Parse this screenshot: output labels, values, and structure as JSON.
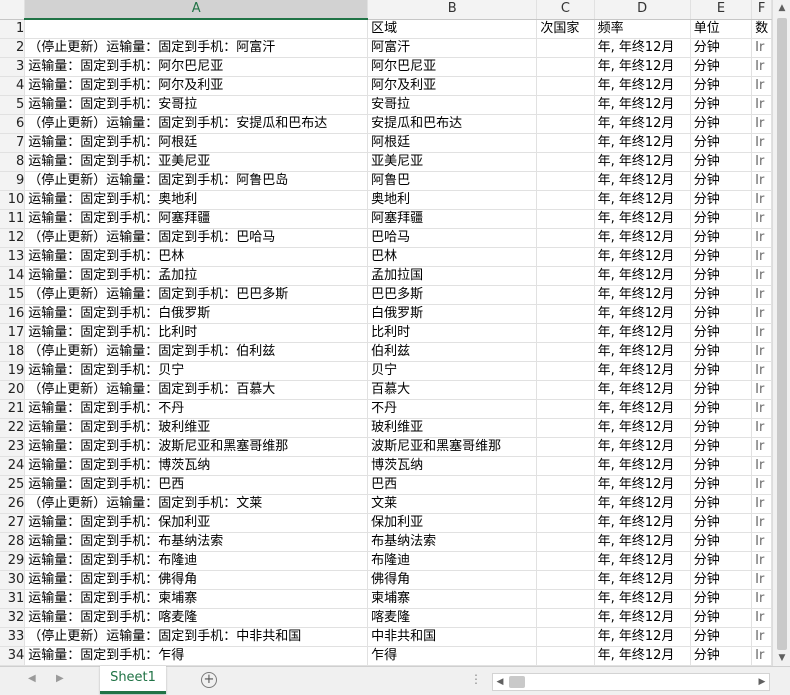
{
  "columns": [
    "A",
    "B",
    "C",
    "D",
    "E",
    "F"
  ],
  "selected_column": "A",
  "header_row": {
    "num": "1",
    "a": "",
    "b": "区域",
    "c": "次国家",
    "d": "频率",
    "e": "单位",
    "f": "数"
  },
  "rows": [
    {
      "num": "2",
      "a": "（停止更新）运输量：固定到手机：阿富汗",
      "b": "阿富汗",
      "d": "年, 年终12月",
      "e": "分钟",
      "f": "Ir"
    },
    {
      "num": "3",
      "a": "运输量：固定到手机：阿尔巴尼亚",
      "b": "阿尔巴尼亚",
      "d": "年, 年终12月",
      "e": "分钟",
      "f": "Ir"
    },
    {
      "num": "4",
      "a": "运输量：固定到手机：阿尔及利亚",
      "b": "阿尔及利亚",
      "d": "年, 年终12月",
      "e": "分钟",
      "f": "Ir"
    },
    {
      "num": "5",
      "a": "运输量：固定到手机：安哥拉",
      "b": "安哥拉",
      "d": "年, 年终12月",
      "e": "分钟",
      "f": "Ir"
    },
    {
      "num": "6",
      "a": "（停止更新）运输量：固定到手机：安提瓜和巴布达",
      "b": "安提瓜和巴布达",
      "d": "年, 年终12月",
      "e": "分钟",
      "f": "Ir"
    },
    {
      "num": "7",
      "a": "运输量：固定到手机：阿根廷",
      "b": "阿根廷",
      "d": "年, 年终12月",
      "e": "分钟",
      "f": "Ir"
    },
    {
      "num": "8",
      "a": "运输量：固定到手机：亚美尼亚",
      "b": "亚美尼亚",
      "d": "年, 年终12月",
      "e": "分钟",
      "f": "Ir"
    },
    {
      "num": "9",
      "a": "（停止更新）运输量：固定到手机：阿鲁巴岛",
      "b": "阿鲁巴",
      "d": "年, 年终12月",
      "e": "分钟",
      "f": "Ir"
    },
    {
      "num": "10",
      "a": "运输量：固定到手机：奥地利",
      "b": "奥地利",
      "d": "年, 年终12月",
      "e": "分钟",
      "f": "Ir"
    },
    {
      "num": "11",
      "a": "运输量：固定到手机：阿塞拜疆",
      "b": "阿塞拜疆",
      "d": "年, 年终12月",
      "e": "分钟",
      "f": "Ir"
    },
    {
      "num": "12",
      "a": "（停止更新）运输量：固定到手机：巴哈马",
      "b": "巴哈马",
      "d": "年, 年终12月",
      "e": "分钟",
      "f": "Ir"
    },
    {
      "num": "13",
      "a": "运输量：固定到手机：巴林",
      "b": "巴林",
      "d": "年, 年终12月",
      "e": "分钟",
      "f": "Ir"
    },
    {
      "num": "14",
      "a": "运输量：固定到手机：孟加拉",
      "b": "孟加拉国",
      "d": "年, 年终12月",
      "e": "分钟",
      "f": "Ir"
    },
    {
      "num": "15",
      "a": "（停止更新）运输量：固定到手机：巴巴多斯",
      "b": "巴巴多斯",
      "d": "年, 年终12月",
      "e": "分钟",
      "f": "Ir"
    },
    {
      "num": "16",
      "a": "运输量：固定到手机：白俄罗斯",
      "b": "白俄罗斯",
      "d": "年, 年终12月",
      "e": "分钟",
      "f": "Ir"
    },
    {
      "num": "17",
      "a": "运输量：固定到手机：比利时",
      "b": "比利时",
      "d": "年, 年终12月",
      "e": "分钟",
      "f": "Ir"
    },
    {
      "num": "18",
      "a": "（停止更新）运输量：固定到手机：伯利兹",
      "b": "伯利兹",
      "d": "年, 年终12月",
      "e": "分钟",
      "f": "Ir"
    },
    {
      "num": "19",
      "a": "运输量：固定到手机：贝宁",
      "b": "贝宁",
      "d": "年, 年终12月",
      "e": "分钟",
      "f": "Ir"
    },
    {
      "num": "20",
      "a": "（停止更新）运输量：固定到手机：百慕大",
      "b": "百慕大",
      "d": "年, 年终12月",
      "e": "分钟",
      "f": "Ir"
    },
    {
      "num": "21",
      "a": "运输量：固定到手机：不丹",
      "b": "不丹",
      "d": "年, 年终12月",
      "e": "分钟",
      "f": "Ir"
    },
    {
      "num": "22",
      "a": "运输量：固定到手机：玻利维亚",
      "b": "玻利维亚",
      "d": "年, 年终12月",
      "e": "分钟",
      "f": "Ir"
    },
    {
      "num": "23",
      "a": "运输量：固定到手机：波斯尼亚和黑塞哥维那",
      "b": "波斯尼亚和黑塞哥维那",
      "d": "年, 年终12月",
      "e": "分钟",
      "f": "Ir"
    },
    {
      "num": "24",
      "a": "运输量：固定到手机：博茨瓦纳",
      "b": "博茨瓦纳",
      "d": "年, 年终12月",
      "e": "分钟",
      "f": "Ir"
    },
    {
      "num": "25",
      "a": "运输量：固定到手机：巴西",
      "b": "巴西",
      "d": "年, 年终12月",
      "e": "分钟",
      "f": "Ir"
    },
    {
      "num": "26",
      "a": "（停止更新）运输量：固定到手机：文莱",
      "b": "文莱",
      "d": "年, 年终12月",
      "e": "分钟",
      "f": "Ir"
    },
    {
      "num": "27",
      "a": "运输量：固定到手机：保加利亚",
      "b": "保加利亚",
      "d": "年, 年终12月",
      "e": "分钟",
      "f": "Ir"
    },
    {
      "num": "28",
      "a": "运输量：固定到手机：布基纳法索",
      "b": "布基纳法索",
      "d": "年, 年终12月",
      "e": "分钟",
      "f": "Ir"
    },
    {
      "num": "29",
      "a": "运输量：固定到手机：布隆迪",
      "b": "布隆迪",
      "d": "年, 年终12月",
      "e": "分钟",
      "f": "Ir"
    },
    {
      "num": "30",
      "a": "运输量：固定到手机：佛得角",
      "b": "佛得角",
      "d": "年, 年终12月",
      "e": "分钟",
      "f": "Ir"
    },
    {
      "num": "31",
      "a": "运输量：固定到手机：柬埔寨",
      "b": "柬埔寨",
      "d": "年, 年终12月",
      "e": "分钟",
      "f": "Ir"
    },
    {
      "num": "32",
      "a": "运输量：固定到手机：喀麦隆",
      "b": "喀麦隆",
      "d": "年, 年终12月",
      "e": "分钟",
      "f": "Ir"
    },
    {
      "num": "33",
      "a": "（停止更新）运输量：固定到手机：中非共和国",
      "b": "中非共和国",
      "d": "年, 年终12月",
      "e": "分钟",
      "f": "Ir"
    },
    {
      "num": "34",
      "a": "运输量：固定到手机：乍得",
      "b": "乍得",
      "d": "年, 年终12月",
      "e": "分钟",
      "f": "Ir"
    }
  ],
  "sheet_tabs": [
    {
      "label": "Sheet1",
      "active": true
    }
  ],
  "icons": {
    "add_sheet": "plus-circle-icon",
    "prev_sheet": "triangle-left-icon",
    "next_sheet": "triangle-right-icon",
    "scroll_up": "triangle-up-icon",
    "scroll_down": "triangle-down-icon",
    "scroll_left": "triangle-left-icon",
    "scroll_right": "triangle-right-icon"
  },
  "colors": {
    "accent": "#217346",
    "header_bg": "#f3f3f3",
    "gridline": "#e1e1e1"
  }
}
